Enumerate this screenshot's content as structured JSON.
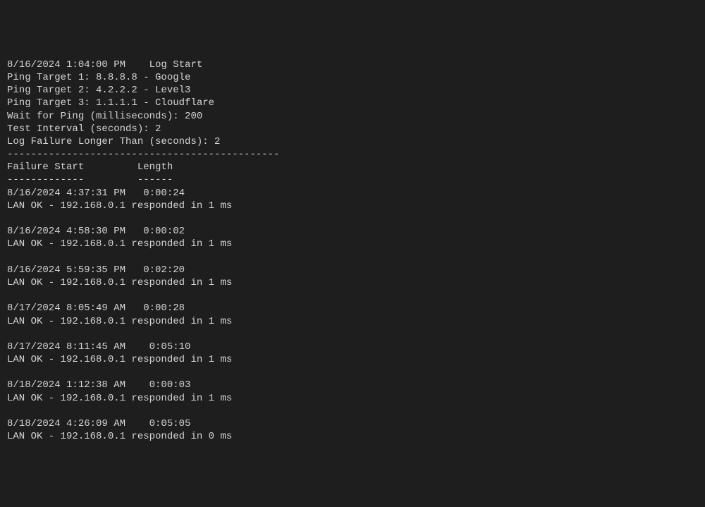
{
  "header": {
    "logStart": "8/16/2024 1:04:00 PM    Log Start",
    "pingTarget1": "Ping Target 1: 8.8.8.8 - Google",
    "pingTarget2": "Ping Target 2: 4.2.2.2 - Level3",
    "pingTarget3": "Ping Target 3: 1.1.1.1 - Cloudflare",
    "waitForPing": "Wait for Ping (milliseconds): 200",
    "testInterval": "Test Interval (seconds): 2",
    "logFailure": "Log Failure Longer Than (seconds): 2",
    "sep1": "----------------------------------------------",
    "columns": "Failure Start         Length",
    "sep2": "-------------         ------"
  },
  "entries": [
    {
      "line1": "8/16/2024 4:37:31 PM   0:00:24",
      "line2": "LAN OK - 192.168.0.1 responded in 1 ms"
    },
    {
      "line1": "8/16/2024 4:58:30 PM   0:00:02",
      "line2": "LAN OK - 192.168.0.1 responded in 1 ms"
    },
    {
      "line1": "8/16/2024 5:59:35 PM   0:02:20",
      "line2": "LAN OK - 192.168.0.1 responded in 1 ms"
    },
    {
      "line1": "8/17/2024 8:05:49 AM   0:00:28",
      "line2": "LAN OK - 192.168.0.1 responded in 1 ms"
    },
    {
      "line1": "8/17/2024 8:11:45 AM    0:05:10",
      "line2": "LAN OK - 192.168.0.1 responded in 1 ms"
    },
    {
      "line1": "8/18/2024 1:12:38 AM    0:00:03",
      "line2": "LAN OK - 192.168.0.1 responded in 1 ms"
    },
    {
      "line1": "8/18/2024 4:26:09 AM    0:05:05",
      "line2": "LAN OK - 192.168.0.1 responded in 0 ms"
    }
  ]
}
